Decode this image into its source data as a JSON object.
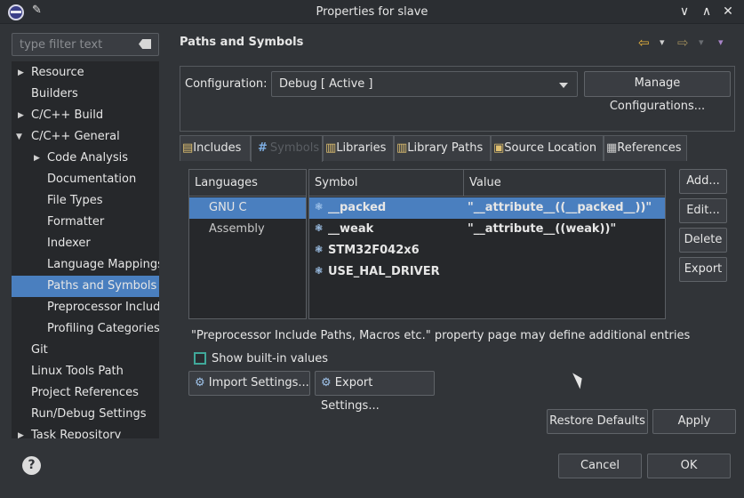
{
  "window": {
    "title": "Properties for slave",
    "app_icon": "eclipse-icon",
    "pin_icon": "pin-icon",
    "min_glyph": "∨",
    "max_glyph": "∧",
    "close_glyph": "✕"
  },
  "sidebar": {
    "filter_placeholder": "type filter text",
    "items": [
      {
        "label": "Resource",
        "expandable": true,
        "expanded": false
      },
      {
        "label": "Builders"
      },
      {
        "label": "C/C++ Build",
        "expandable": true,
        "expanded": false
      },
      {
        "label": "C/C++ General",
        "expandable": true,
        "expanded": true
      },
      {
        "label": "Code Analysis",
        "expandable": true,
        "expanded": false
      },
      {
        "label": "Documentation"
      },
      {
        "label": "File Types"
      },
      {
        "label": "Formatter"
      },
      {
        "label": "Indexer"
      },
      {
        "label": "Language Mappings"
      },
      {
        "label": "Paths and Symbols",
        "selected": true
      },
      {
        "label": "Preprocessor Include"
      },
      {
        "label": "Profiling Categories"
      },
      {
        "label": "Git"
      },
      {
        "label": "Linux Tools Path"
      },
      {
        "label": "Project References"
      },
      {
        "label": "Run/Debug Settings"
      },
      {
        "label": "Task Repository",
        "expandable": true,
        "expanded": false
      }
    ]
  },
  "page": {
    "title": "Paths and Symbols",
    "back_glyph": "⇦",
    "forward_glyph": "⇨",
    "menu_glyph": "▾"
  },
  "configuration": {
    "label": "Configuration:",
    "selected": "Debug  [ Active ]",
    "manage_label": "Manage Configurations..."
  },
  "tabs": [
    {
      "label": "Includes",
      "icon": "includes-icon"
    },
    {
      "label": "Symbols",
      "icon": "hash-icon",
      "active": true
    },
    {
      "label": "Libraries",
      "icon": "libraries-icon"
    },
    {
      "label": "Library Paths",
      "icon": "library-paths-icon"
    },
    {
      "label": "Source Location",
      "icon": "source-location-icon"
    },
    {
      "label": "References",
      "icon": "references-icon"
    }
  ],
  "languages": {
    "header": "Languages",
    "items": [
      {
        "label": "GNU C",
        "selected": true
      },
      {
        "label": "Assembly"
      }
    ]
  },
  "symbols": {
    "col_symbol": "Symbol",
    "col_value": "Value",
    "rows": [
      {
        "symbol": "__packed",
        "value": "\"__attribute__((__packed__))\"",
        "selected": true
      },
      {
        "symbol": "__weak",
        "value": "\"__attribute__((weak))\""
      },
      {
        "symbol": "STM32F042x6",
        "value": ""
      },
      {
        "symbol": "USE_HAL_DRIVER",
        "value": ""
      }
    ]
  },
  "side_buttons": {
    "add": "Add...",
    "edit": "Edit...",
    "delete": "Delete",
    "export": "Export"
  },
  "note": "\"Preprocessor Include Paths, Macros etc.\" property page may define additional entries",
  "show_builtin": {
    "label": "Show built-in values",
    "checked": false
  },
  "import_label": "Import Settings...",
  "export_label": "Export Settings...",
  "restore_label": "Restore Defaults",
  "apply_label": "Apply",
  "cancel_label": "Cancel",
  "ok_label": "OK",
  "help_glyph": "?",
  "colors": {
    "background": "#313438",
    "selection": "#4a7fbf",
    "list_background": "#26282b",
    "checkbox_accent": "#40a89a"
  }
}
